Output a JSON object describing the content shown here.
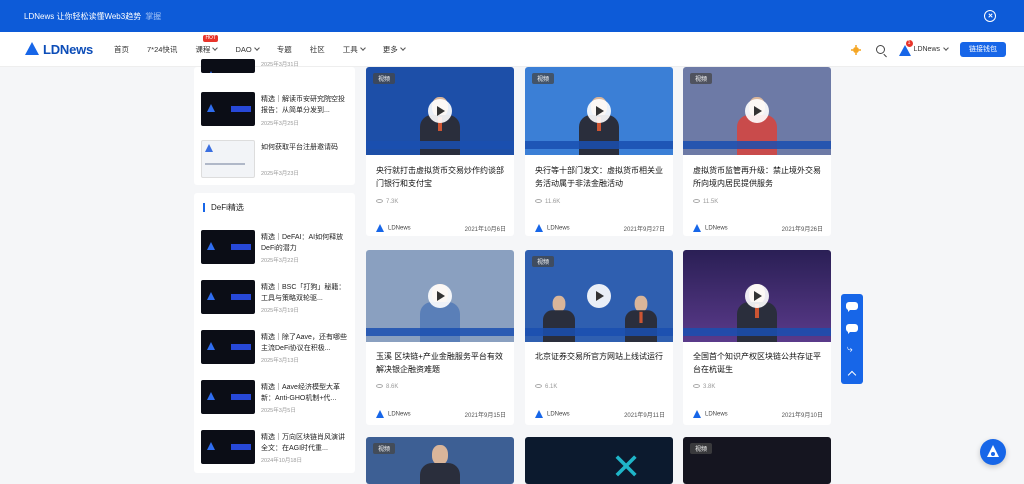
{
  "banner": {
    "text": "LDNews 让你轻松读懂Web3趋势",
    "sub": "掌握"
  },
  "nav": {
    "logo": "LDNews",
    "items": [
      {
        "label": "首页"
      },
      {
        "label": "7*24快讯"
      },
      {
        "label": "课程",
        "badge": "HOT"
      },
      {
        "label": "DAO"
      },
      {
        "label": "专题"
      },
      {
        "label": "社区"
      },
      {
        "label": "工具"
      },
      {
        "label": "更多"
      }
    ],
    "account": "LDNews",
    "notif_count": "1",
    "connect": "链接钱包"
  },
  "sidebar": {
    "top_items": [
      {
        "title": "",
        "date": "2025年3月31日"
      },
      {
        "title": "精选｜解读币安研究院空投报告：从简单分发到...",
        "date": "2025年3月25日"
      },
      {
        "title": "如何获取平台注册邀请码",
        "date": "2025年3月23日"
      }
    ],
    "defi_title": "DeFi精选",
    "defi_items": [
      {
        "title": "精选｜DeFAI：AI如何释放DeFi的潜力",
        "date": "2025年3月22日"
      },
      {
        "title": "精选｜BSC「打狗」秘籍：工具与策略双轮驱...",
        "date": "2025年3月19日"
      },
      {
        "title": "精选｜除了Aave，还有哪些主流DeFi协议在积极...",
        "date": "2025年3月13日"
      },
      {
        "title": "精选｜Aave经济模型大革新：Anti-GHO机制+代...",
        "date": "2025年3月5日"
      },
      {
        "title": "精选｜万向区块链肖风演讲全文：在AGI时代重...",
        "date": "2024年10月18日"
      }
    ]
  },
  "cards": [
    {
      "badge": "视频",
      "title": "央行就打击虚拟货币交易炒作约谈部门银行和支付宝",
      "views": "7.3K",
      "author": "LDNews",
      "date": "2021年10月6日",
      "bg": "#1d4fa8"
    },
    {
      "badge": "视频",
      "title": "央行等十部门发文：虚拟货币相关业务活动属于非法金融活动",
      "views": "11.6K",
      "author": "LDNews",
      "date": "2021年9月27日",
      "bg": "#3b7fd6"
    },
    {
      "badge": "视频",
      "title": "虚拟货币监管再升级：禁止境外交易所向境内居民提供服务",
      "views": "11.5K",
      "author": "LDNews",
      "date": "2021年9月26日",
      "bg": "#6d7aa6"
    },
    {
      "badge": "",
      "title": "玉溪 区块链+产业金融服务平台有效解决银企融资难题",
      "views": "8.6K",
      "author": "LDNews",
      "date": "2021年9月15日",
      "bg": "#8aa0c0"
    },
    {
      "badge": "视频",
      "title": "北京证券交易所官方网站上线试运行",
      "views": "6.1K",
      "author": "LDNews",
      "date": "2021年9月11日",
      "bg": "#2f5fb0"
    },
    {
      "badge": "",
      "title": "全国首个知识产权区块链公共存证平台在杭诞生",
      "views": "3.8K",
      "author": "LDNews",
      "date": "2021年9月10日",
      "bg": "#3a2a6a"
    },
    {
      "badge": "视频",
      "title": "",
      "views": "",
      "author": "",
      "date": "",
      "bg": "#3d5f94"
    },
    {
      "badge": "",
      "title": "",
      "views": "",
      "author": "",
      "date": "",
      "bg": "#0c1a2e"
    },
    {
      "badge": "视频",
      "title": "",
      "views": "",
      "author": "",
      "date": "",
      "bg": "#151520"
    }
  ]
}
